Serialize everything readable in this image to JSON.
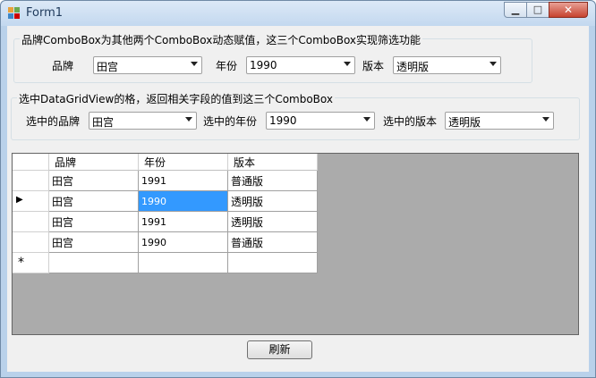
{
  "window": {
    "title": "Form1"
  },
  "group1": {
    "title": "品牌ComboBox为其他两个ComboBox动态赋值，这三个ComboBox实现筛选功能",
    "brand_label": "品牌",
    "brand_value": "田宫",
    "year_label": "年份",
    "year_value": "1990",
    "version_label": "版本",
    "version_value": "透明版"
  },
  "group2": {
    "title": "选中DataGridView的格，返回相关字段的值到这三个ComboBox",
    "brand_label": "选中的品牌",
    "brand_value": "田宫",
    "year_label": "选中的年份",
    "year_value": "1990",
    "version_label": "选中的版本",
    "version_value": "透明版"
  },
  "grid": {
    "columns": [
      "品牌",
      "年份",
      "版本"
    ],
    "rows": [
      [
        "田宫",
        "1991",
        "普通版"
      ],
      [
        "田宫",
        "1990",
        "透明版"
      ],
      [
        "田宫",
        "1991",
        "透明版"
      ],
      [
        "田宫",
        "1990",
        "普通版"
      ]
    ],
    "current_row_marker": "▶",
    "new_row_marker": "*"
  },
  "refresh_button": "刷新"
}
